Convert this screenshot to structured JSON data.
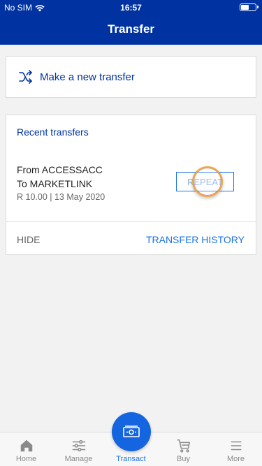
{
  "status_bar": {
    "carrier": "No SIM",
    "time": "16:57",
    "battery_level": 0.6
  },
  "header": {
    "title": "Transfer"
  },
  "new_transfer": {
    "label": "Make a new transfer",
    "icon": "shuffle-icon"
  },
  "recent": {
    "title": "Recent transfers",
    "item": {
      "from": "From ACCESSACC",
      "to": "To MARKETLINK",
      "meta": "R 10.00 | 13 May 2020",
      "repeat_label": "REPEAT"
    },
    "hide_label": "HIDE",
    "history_label": "TRANSFER HISTORY"
  },
  "tabs": [
    {
      "label": "Home",
      "icon": "home-icon"
    },
    {
      "label": "Manage",
      "icon": "sliders-icon"
    },
    {
      "label": "Transact",
      "icon": "cash-icon",
      "active": true
    },
    {
      "label": "Buy",
      "icon": "cart-icon"
    },
    {
      "label": "More",
      "icon": "menu-icon"
    }
  ],
  "colors": {
    "brand": "#0033a1",
    "accent": "#1a73e8",
    "background": "#f2f2f2"
  }
}
